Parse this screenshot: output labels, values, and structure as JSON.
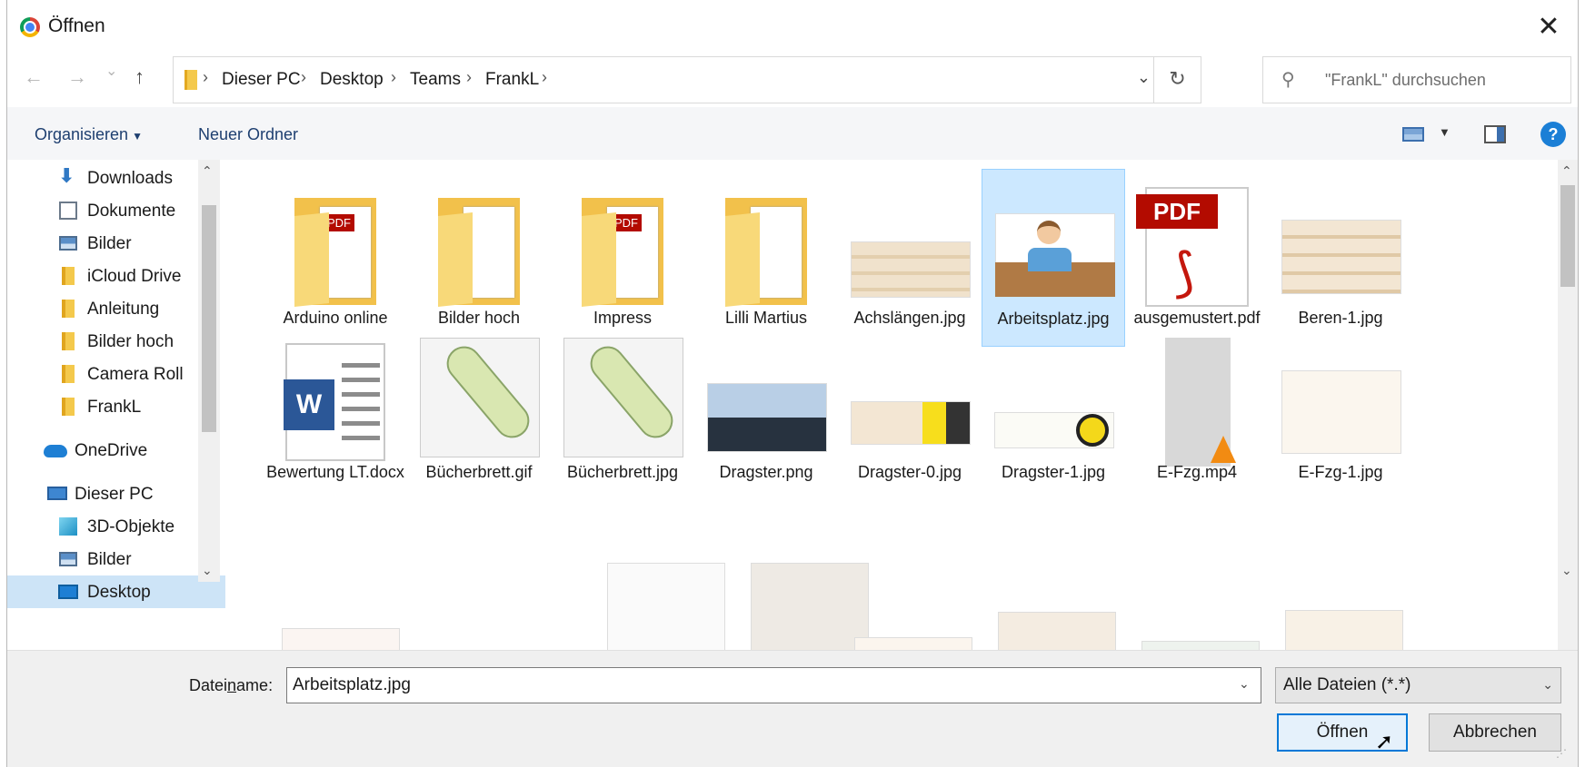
{
  "window": {
    "title": "Öffnen",
    "close_glyph": "✕"
  },
  "navigation": {
    "back_glyph": "←",
    "forward_glyph": "→",
    "recent_glyph": "⌄",
    "up_glyph": "↑",
    "breadcrumb": [
      "Dieser PC",
      "Desktop",
      "Teams",
      "FrankL"
    ],
    "sep_glyph": "›",
    "dropdown_glyph": "⌄",
    "refresh_glyph": "↻",
    "search_placeholder": "\"FrankL\" durchsuchen",
    "search_glyph": "⚲"
  },
  "toolbar": {
    "organize": "Organisieren",
    "organize_caret": "▼",
    "new_folder": "Neuer Ordner",
    "view_caret": "▼",
    "help": "?"
  },
  "sidebar": {
    "items": [
      {
        "label": "Downloads",
        "icon": "download-icon",
        "pinned": true,
        "pin": "📌"
      },
      {
        "label": "Dokumente",
        "icon": "documents-icon",
        "pinned": true,
        "pin": "📌"
      },
      {
        "label": "Bilder",
        "icon": "pictures-icon",
        "pinned": true,
        "pin": "📌"
      },
      {
        "label": "iCloud Drive",
        "icon": "folder-icon",
        "pinned": true,
        "pin": "📌"
      },
      {
        "label": "Anleitung",
        "icon": "folder-icon"
      },
      {
        "label": "Bilder hoch",
        "icon": "folder-icon"
      },
      {
        "label": "Camera Roll",
        "icon": "folder-icon"
      },
      {
        "label": "FrankL",
        "icon": "folder-icon"
      },
      {
        "label": "OneDrive",
        "icon": "cloud-icon"
      },
      {
        "label": "Dieser PC",
        "icon": "pc-icon"
      },
      {
        "label": "3D-Objekte",
        "icon": "3d-objects-icon"
      },
      {
        "label": "Bilder",
        "icon": "pictures-icon"
      },
      {
        "label": "Desktop",
        "icon": "desktop-icon",
        "selected": true
      }
    ]
  },
  "files": [
    {
      "name": "Arduino online",
      "kind": "folder-pdf"
    },
    {
      "name": "Bilder hoch",
      "kind": "folder-doc"
    },
    {
      "name": "Impress",
      "kind": "folder-pdf"
    },
    {
      "name": "Lilli Martius",
      "kind": "folder-doc"
    },
    {
      "name": "Achslängen.jpg",
      "kind": "image"
    },
    {
      "name": "Arbeitsplatz.jpg",
      "kind": "image",
      "selected": true
    },
    {
      "name": "ausgemustert.pdf",
      "kind": "pdf"
    },
    {
      "name": "Beren-1.jpg",
      "kind": "image"
    },
    {
      "name": "Bewertung LT.docx",
      "kind": "word"
    },
    {
      "name": "Bücherbrett.gif",
      "kind": "board"
    },
    {
      "name": "Bücherbrett.jpg",
      "kind": "board"
    },
    {
      "name": "Dragster.png",
      "kind": "image"
    },
    {
      "name": "Dragster-0.jpg",
      "kind": "image"
    },
    {
      "name": "Dragster-1.jpg",
      "kind": "image"
    },
    {
      "name": "E-Fzg.mp4",
      "kind": "video"
    },
    {
      "name": "E-Fzg-1.jpg",
      "kind": "image"
    }
  ],
  "pdf_tag": "PDF",
  "word_tag": "W",
  "footer": {
    "filename_label_pre": "Datei",
    "filename_label_u": "n",
    "filename_label_post": "ame:",
    "filename_value": "Arbeitsplatz.jpg",
    "filter_value": "Alle Dateien (*.*)",
    "dropdown_glyph": "⌄",
    "open_label": "Öffnen",
    "cancel_label": "Abbrechen",
    "grip_glyph": "⋰"
  },
  "scroll": {
    "up_glyph": "⌃",
    "down_glyph": "⌄"
  },
  "colors": {
    "accent": "#0078d7",
    "selection": "#cce8ff",
    "folder": "#f4c94c",
    "pdf_red": "#b30b00",
    "word_blue": "#2b5797"
  }
}
